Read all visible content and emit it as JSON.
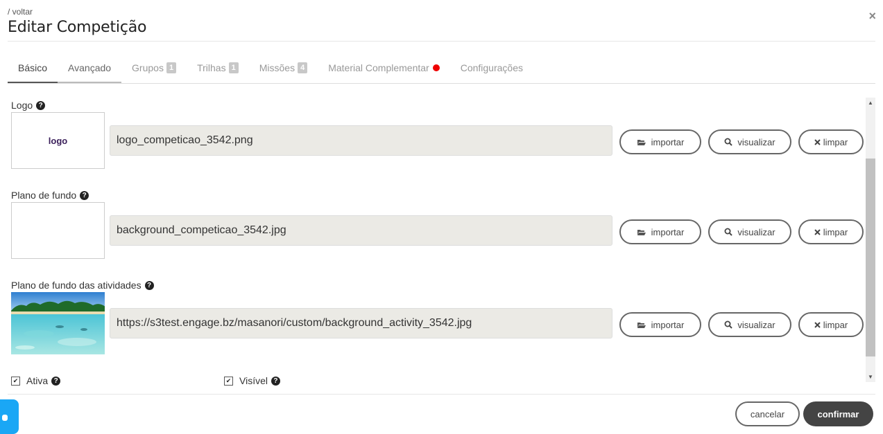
{
  "header": {
    "breadcrumb": "/ voltar",
    "title": "Editar Competição",
    "close_label": "×"
  },
  "tabs": [
    {
      "label": "Básico"
    },
    {
      "label": "Avançado"
    },
    {
      "label": "Grupos",
      "count": "1"
    },
    {
      "label": "Trilhas",
      "count": "1"
    },
    {
      "label": "Missões",
      "count": "4"
    },
    {
      "label": "Material Complementar"
    },
    {
      "label": "Configurações"
    }
  ],
  "fields": {
    "logo": {
      "label": "Logo",
      "preview_text": "logo",
      "value": "logo_competicao_3542.png"
    },
    "background": {
      "label": "Plano de fundo",
      "value": "background_competicao_3542.jpg"
    },
    "activity_background": {
      "label": "Plano de fundo das atividades",
      "value": "https://s3test.engage.bz/masanori/custom/background_activity_3542.jpg"
    }
  },
  "buttons": {
    "import": "importar",
    "view": "visualizar",
    "clear": "limpar"
  },
  "checkboxes": {
    "active": "Ativa",
    "visible": "Visível"
  },
  "footer": {
    "cancel": "cancelar",
    "confirm": "confirmar"
  },
  "colors": {
    "accent_dark": "#444444",
    "notification_dot": "#ee0000",
    "input_bg": "#ebeae5",
    "chat_widget": "#1aa7f5"
  },
  "icons": {
    "help": "question-circle-icon",
    "import": "folder-open-icon",
    "view": "search-icon",
    "clear": "times-icon"
  }
}
